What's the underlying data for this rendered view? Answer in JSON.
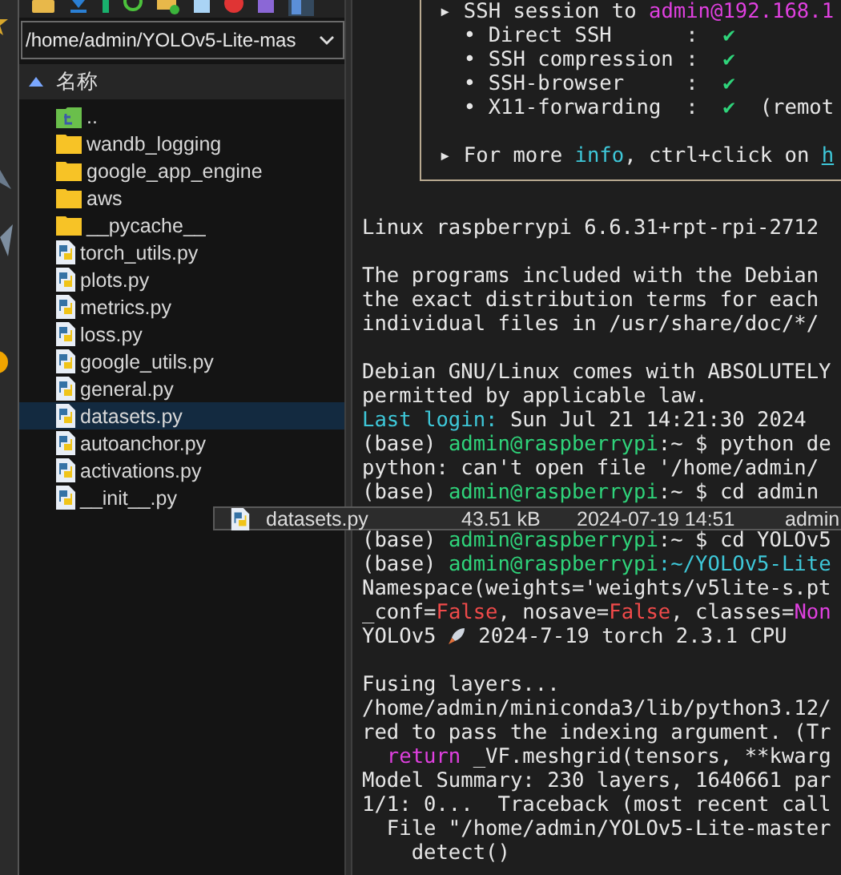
{
  "path_field": {
    "value": "/home/admin/YOLOv5-Lite-mas"
  },
  "file_list": {
    "header": "名称",
    "sort_ascending": true,
    "items": [
      {
        "name": "..",
        "kind": "parent",
        "selected": false
      },
      {
        "name": "wandb_logging",
        "kind": "folder",
        "selected": false
      },
      {
        "name": "google_app_engine",
        "kind": "folder",
        "selected": false
      },
      {
        "name": "aws",
        "kind": "folder",
        "selected": false
      },
      {
        "name": "__pycache__",
        "kind": "folder",
        "selected": false
      },
      {
        "name": "torch_utils.py",
        "kind": "python",
        "selected": false
      },
      {
        "name": "plots.py",
        "kind": "python",
        "selected": false
      },
      {
        "name": "metrics.py",
        "kind": "python",
        "selected": false
      },
      {
        "name": "loss.py",
        "kind": "python",
        "selected": false
      },
      {
        "name": "google_utils.py",
        "kind": "python",
        "selected": false
      },
      {
        "name": "general.py",
        "kind": "python",
        "selected": false
      },
      {
        "name": "datasets.py",
        "kind": "python",
        "selected": true
      },
      {
        "name": "autoanchor.py",
        "kind": "python",
        "selected": false
      },
      {
        "name": "activations.py",
        "kind": "python",
        "selected": false
      },
      {
        "name": "__init__.py",
        "kind": "python",
        "selected": false
      }
    ]
  },
  "drag_tooltip": {
    "name": "datasets.py",
    "size": "43.51 kB",
    "date": "2024-07-19 14:51",
    "owner": "admin"
  },
  "terminal": {
    "session_box": [
      {
        "segments": [
          {
            "text": "▸ SSH session to ",
            "kind": "plain"
          },
          {
            "text": "admin@192.168.1",
            "kind": "accent"
          }
        ]
      },
      {
        "segments": [
          {
            "text": "  • Direct SSH      :  ",
            "kind": "plain"
          },
          {
            "text": "✔",
            "kind": "ok"
          }
        ]
      },
      {
        "segments": [
          {
            "text": "  • SSH compression :  ",
            "kind": "plain"
          },
          {
            "text": "✔",
            "kind": "ok"
          }
        ]
      },
      {
        "segments": [
          {
            "text": "  • SSH-browser     :  ",
            "kind": "plain"
          },
          {
            "text": "✔",
            "kind": "ok"
          }
        ]
      },
      {
        "segments": [
          {
            "text": "  • X11-forwarding  :  ",
            "kind": "plain"
          },
          {
            "text": "✔",
            "kind": "ok"
          },
          {
            "text": "  (remot",
            "kind": "plain"
          }
        ]
      },
      {
        "blank_before": true,
        "segments": [
          {
            "text": "▸ For more ",
            "kind": "plain"
          },
          {
            "text": "info",
            "kind": "info"
          },
          {
            "text": ", ctrl+click on ",
            "kind": "plain"
          },
          {
            "text": "h",
            "kind": "link"
          }
        ]
      }
    ],
    "lines": [
      {
        "segments": [
          {
            "text": "Linux raspberrypi 6.6.31+rpt-rpi-2712",
            "kind": "plain"
          }
        ]
      },
      {
        "blank_before": true,
        "segments": [
          {
            "text": "The programs included with the Debian",
            "kind": "plain"
          }
        ]
      },
      {
        "segments": [
          {
            "text": "the exact distribution terms for each",
            "kind": "plain"
          }
        ]
      },
      {
        "segments": [
          {
            "text": "individual files in /usr/share/doc/*/",
            "kind": "plain"
          }
        ]
      },
      {
        "blank_before": true,
        "segments": [
          {
            "text": "Debian GNU/Linux comes with ABSOLUTELY",
            "kind": "plain"
          }
        ]
      },
      {
        "segments": [
          {
            "text": "permitted by applicable law.",
            "kind": "plain"
          }
        ]
      },
      {
        "segments": [
          {
            "text": "Last login:",
            "kind": "info"
          },
          {
            "text": " Sun Jul 21 14:21:30 2024",
            "kind": "plain"
          }
        ]
      },
      {
        "segments": [
          {
            "text": "(base) ",
            "kind": "plain"
          },
          {
            "text": "admin@raspberrypi",
            "kind": "prompt"
          },
          {
            "text": ":~ $ python de",
            "kind": "plain"
          }
        ]
      },
      {
        "segments": [
          {
            "text": "python: can't open file '/home/admin/",
            "kind": "plain"
          }
        ]
      },
      {
        "segments": [
          {
            "text": "(base) ",
            "kind": "plain"
          },
          {
            "text": "admin@raspberrypi",
            "kind": "prompt"
          },
          {
            "text": ":~ $ cd admin",
            "kind": "plain"
          }
        ]
      },
      {
        "blank_before": true,
        "segments": [
          {
            "text": "(base) ",
            "kind": "plain"
          },
          {
            "text": "admin@raspberrypi",
            "kind": "prompt"
          },
          {
            "text": ":~ $ cd YOLOv5",
            "kind": "plain"
          }
        ]
      },
      {
        "segments": [
          {
            "text": "(base) ",
            "kind": "plain"
          },
          {
            "text": "admin@raspberrypi",
            "kind": "prompt"
          },
          {
            "text": ":~/YOLOv5-Lite",
            "kind": "info"
          }
        ]
      },
      {
        "segments": [
          {
            "text": "Namespace(weights='weights/v5lite-s.pt",
            "kind": "plain"
          }
        ]
      },
      {
        "segments": [
          {
            "text": "_conf=",
            "kind": "plain"
          },
          {
            "text": "False",
            "kind": "error"
          },
          {
            "text": ", nosave=",
            "kind": "plain"
          },
          {
            "text": "False",
            "kind": "error"
          },
          {
            "text": ", classes=",
            "kind": "plain"
          },
          {
            "text": "Non",
            "kind": "accent"
          }
        ]
      },
      {
        "segments": [
          {
            "text": "YOLOv5 ",
            "kind": "plain"
          },
          {
            "kind": "icon"
          },
          {
            "text": " 2024-7-19 torch 2.3.1 CPU",
            "kind": "plain"
          }
        ]
      },
      {
        "blank_before": true,
        "segments": [
          {
            "text": "Fusing layers...",
            "kind": "plain"
          }
        ]
      },
      {
        "segments": [
          {
            "text": "/home/admin/miniconda3/lib/python3.12/",
            "kind": "plain"
          }
        ]
      },
      {
        "segments": [
          {
            "text": "red to pass the indexing argument. (Tr",
            "kind": "plain"
          }
        ]
      },
      {
        "indented": true,
        "segments": [
          {
            "text": "return",
            "kind": "accent"
          },
          {
            "text": " _VF.meshgrid(tensors, **kwarg",
            "kind": "plain"
          }
        ]
      },
      {
        "segments": [
          {
            "text": "Model Summary: 230 layers, 1640661 par",
            "kind": "plain"
          }
        ]
      },
      {
        "segments": [
          {
            "text": "1/1: 0...  Traceback (most recent call",
            "kind": "plain"
          }
        ]
      },
      {
        "segments": [
          {
            "text": "  File \"/home/admin/YOLOv5-Lite-master",
            "kind": "plain"
          }
        ]
      },
      {
        "segments": [
          {
            "text": "    detect()",
            "kind": "plain"
          }
        ]
      }
    ]
  }
}
